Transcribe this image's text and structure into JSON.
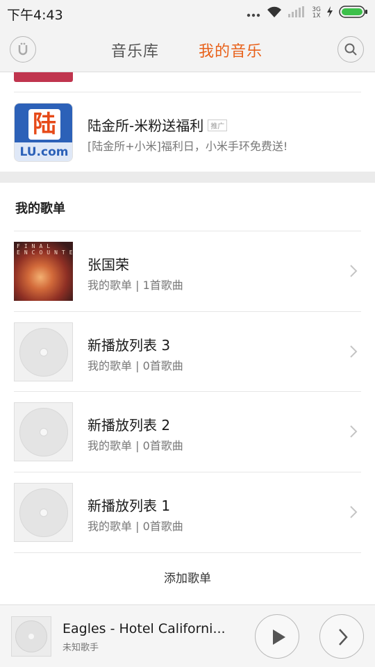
{
  "status_bar": {
    "time": "下午4:43",
    "network_top": "3G",
    "network_bottom": "1X"
  },
  "nav": {
    "tabs": [
      {
        "label": "音乐库",
        "active": false
      },
      {
        "label": "我的音乐",
        "active": true
      }
    ],
    "active_color": "#e8611a",
    "inactive_color": "#555555"
  },
  "ad": {
    "title": "陆金所-米粉送福利",
    "badge": "推广",
    "subtitle": "[陆金所+小米]福利日，小米手环免费送!",
    "icon_char": "陆",
    "icon_text": "LU.com"
  },
  "my_playlists": {
    "title": "我的歌单",
    "items": [
      {
        "name": "张国荣",
        "meta": "我的歌单 | 1首歌曲",
        "cover": "album-cover"
      },
      {
        "name": "新播放列表 3",
        "meta": "我的歌单 | 0首歌曲",
        "cover": "disc-placeholder"
      },
      {
        "name": "新播放列表 2",
        "meta": "我的歌单 | 0首歌曲",
        "cover": "disc-placeholder"
      },
      {
        "name": "新播放列表 1",
        "meta": "我的歌单 | 0首歌曲",
        "cover": "disc-placeholder"
      }
    ],
    "add_label": "添加歌单"
  },
  "player": {
    "title": "Eagles - Hotel Californi...",
    "artist": "未知歌手"
  }
}
